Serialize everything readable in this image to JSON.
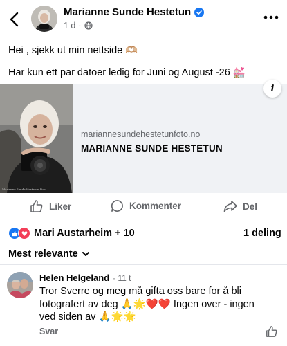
{
  "header": {
    "author": "Marianne Sunde Hestetun",
    "time": "1 d",
    "dot": "·"
  },
  "post": {
    "line1": "Hei , sjekk ut min nettside 🫶🏼",
    "line2": "Har kun ett par datoer ledig for Juni og August -26 💒"
  },
  "link_preview": {
    "url": "mariannesundehestetunfoto.no",
    "title": "MARIANNE SUNDE HESTETUN",
    "info": "i",
    "watermark": "Marianne Sunde Hestetun Foto"
  },
  "actions": {
    "like": "Liker",
    "comment": "Kommenter",
    "share": "Del"
  },
  "reactions": {
    "summary": "Mari Austarheim + 10",
    "shares": "1 deling"
  },
  "comments_sort": "Mest relevante",
  "comment": {
    "author": "Helen Helgeland",
    "time": "· 11 t",
    "text": "Tror Sverre og meg må gifta oss bare for å bli fotografert av deg 🙏🌟❤️❤️ Ingen over - ingen ved siden av 🙏🌟🌟",
    "reply": "Svar"
  },
  "colors": {
    "accent": "#1877f2",
    "love": "#f33e58",
    "muted": "#65676b",
    "preview_bg": "#f0f2f5"
  },
  "icons": [
    "back-arrow-icon",
    "verified-badge-icon",
    "globe-icon",
    "more-icon",
    "info-icon",
    "like-icon",
    "comment-icon",
    "share-icon",
    "like-reaction-icon",
    "love-reaction-icon",
    "chevron-down-icon"
  ]
}
